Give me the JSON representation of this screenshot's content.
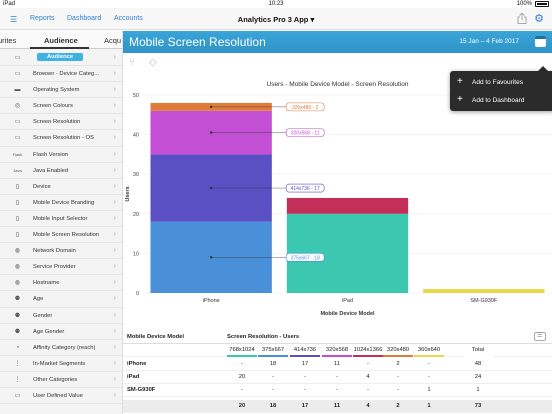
{
  "status": {
    "device": "iPad",
    "time": "10:23",
    "battery": "100%"
  },
  "nav": {
    "reports": "Reports",
    "dashboard": "Dashboard",
    "accounts": "Accounts",
    "title": "Analytics Pro 3 App ▾"
  },
  "sidebar": {
    "tabs": [
      "urites",
      "Audience",
      "Acqu"
    ],
    "items": [
      {
        "label": "Audience",
        "icon": "audience-icon",
        "selected": true
      },
      {
        "label": "Browser - Device Categ...",
        "icon": "browser-icon"
      },
      {
        "label": "Operating System",
        "icon": "os-icon"
      },
      {
        "label": "Screen Colours",
        "icon": "palette-icon"
      },
      {
        "label": "Screen Resolution",
        "icon": "screen-icon"
      },
      {
        "label": "Screen Resolution - OS",
        "icon": "screen-icon"
      },
      {
        "label": "Flash Version",
        "icon": "flash-icon"
      },
      {
        "label": "Java Enabled",
        "icon": "java-icon"
      },
      {
        "label": "Device",
        "icon": "device-icon"
      },
      {
        "label": "Mobile Device Branding",
        "icon": "mobile-icon"
      },
      {
        "label": "Mobile Input Selector",
        "icon": "mobile-icon"
      },
      {
        "label": "Mobile Screen Resolution",
        "icon": "mobile-icon"
      },
      {
        "label": "Network Domain",
        "icon": "globe-icon"
      },
      {
        "label": "Service Provider",
        "icon": "globe-icon"
      },
      {
        "label": "Hostname",
        "icon": "globe-icon"
      },
      {
        "label": "Age",
        "icon": "people-icon"
      },
      {
        "label": "Gender",
        "icon": "people-icon"
      },
      {
        "label": "Age Gender",
        "icon": "people-icon"
      },
      {
        "label": "Affinity Category (reach)",
        "icon": "affinity-icon"
      },
      {
        "label": "In-Market Segments",
        "icon": "segments-icon"
      },
      {
        "label": "Other Categories",
        "icon": "segments-icon"
      },
      {
        "label": "User Defined Value",
        "icon": "user-icon"
      }
    ]
  },
  "header": {
    "title": "Mobile Screen Resolution",
    "date": "15 Jan – 4 Feb 2017"
  },
  "menu": {
    "add_favourites": "Add to Favourites",
    "add_dashboard": "Add to Dashboard"
  },
  "chart_data": {
    "type": "bar",
    "title": "Users - Mobile Device Model - Screen Resolution",
    "xlabel": "Mobile Device Model",
    "ylabel": "Users",
    "ylim": [
      0,
      50
    ],
    "yticks": [
      0,
      10,
      20,
      30,
      40,
      50
    ],
    "categories": [
      "iPhone",
      "iPad",
      "SM-G930F"
    ],
    "series": [
      {
        "name": "375x667",
        "color": "#4a90d9",
        "values": [
          18,
          0,
          0
        ]
      },
      {
        "name": "414x736",
        "color": "#5b4fc4",
        "values": [
          17,
          0,
          0
        ]
      },
      {
        "name": "320x568",
        "color": "#c24fd4",
        "values": [
          11,
          0,
          0
        ]
      },
      {
        "name": "320x480",
        "color": "#e07b3a",
        "values": [
          2,
          0,
          0
        ]
      },
      {
        "name": "768x1024",
        "color": "#3cc7b0",
        "values": [
          0,
          20,
          0
        ]
      },
      {
        "name": "1024x1366",
        "color": "#c2305a",
        "values": [
          0,
          4,
          0
        ]
      },
      {
        "name": "360x640",
        "color": "#e8d84a",
        "values": [
          0,
          0,
          1
        ]
      }
    ],
    "labels": [
      {
        "text": "375x667 - 18",
        "series": "375x667"
      },
      {
        "text": "414x736 - 17",
        "series": "414x736"
      },
      {
        "text": "320x568 - 11",
        "series": "320x568"
      },
      {
        "text": "320x480 - 2",
        "series": "320x480"
      }
    ],
    "grid": true
  },
  "table": {
    "col1": "Mobile Device Model",
    "col2": "Screen Resolution - Users",
    "columns": [
      "768x1024",
      "375x667",
      "414x736",
      "320x568",
      "1024x1366",
      "320x480",
      "360x640",
      "Total"
    ],
    "colors": [
      "#3cc7b0",
      "#4a90d9",
      "#5b4fc4",
      "#c24fd4",
      "#c2305a",
      "#e07b3a",
      "#e8d84a",
      "#ffffff"
    ],
    "rows": [
      {
        "name": "iPhone",
        "cells": [
          "-",
          "18",
          "17",
          "11",
          "-",
          "2",
          "-",
          "48"
        ]
      },
      {
        "name": "iPad",
        "cells": [
          "20",
          "-",
          "-",
          "-",
          "4",
          "-",
          "-",
          "24"
        ]
      },
      {
        "name": "SM-G930F",
        "cells": [
          "-",
          "-",
          "-",
          "-",
          "-",
          "-",
          "1",
          "1"
        ]
      }
    ],
    "totals": [
      "20",
      "18",
      "17",
      "11",
      "4",
      "2",
      "1",
      "73"
    ]
  }
}
